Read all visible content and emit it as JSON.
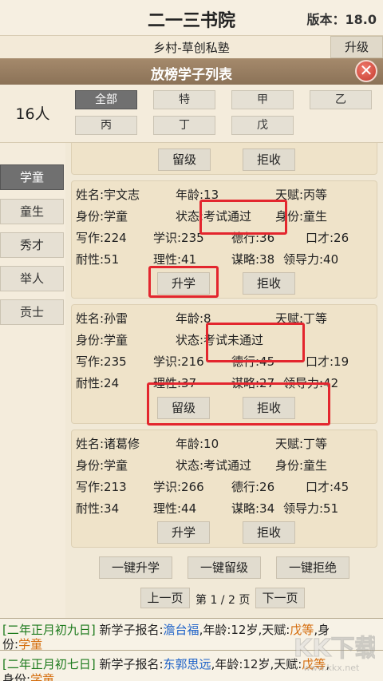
{
  "app": {
    "title": "二一三书院",
    "version_label": "版本：",
    "version_value": "18.0"
  },
  "location": {
    "text": "乡村-草创私塾",
    "upgrade_label": "升级"
  },
  "dialog": {
    "title": "放榜学子列表",
    "close_icon": "close-icon"
  },
  "count_label": "16人",
  "filters": [
    {
      "label": "全部",
      "active": true
    },
    {
      "label": "特"
    },
    {
      "label": "甲"
    },
    {
      "label": "乙"
    },
    {
      "label": "丙"
    },
    {
      "label": "丁"
    },
    {
      "label": "戊"
    }
  ],
  "sidebar": [
    {
      "label": "学童",
      "active": true
    },
    {
      "label": "童生"
    },
    {
      "label": "秀才"
    },
    {
      "label": "举人"
    },
    {
      "label": "贡士"
    }
  ],
  "partial_card": {
    "btn1": "留级",
    "btn2": "拒收"
  },
  "cards": [
    {
      "name": "姓名:宇文志",
      "age": "年龄:13",
      "talent": "天赋:丙等",
      "identity": "身份:学童",
      "status": "状态:考试通过",
      "identity2": "身份:童生",
      "writing": "写作:224",
      "knowledge": "学识:235",
      "virtue": "德行:36",
      "eloquence": "口才:26",
      "patience": "耐性:51",
      "reason": "理性:41",
      "strategy": "谋略:38",
      "leadership": "领导力:40",
      "btn1": "升学",
      "btn2": "拒收"
    },
    {
      "name": "姓名:孙雷",
      "age": "年龄:8",
      "talent": "天赋:丁等",
      "identity": "身份:学童",
      "status": "状态:考试未通过",
      "identity2": "",
      "writing": "写作:235",
      "knowledge": "学识:216",
      "virtue": "德行:45",
      "eloquence": "口才:19",
      "patience": "耐性:24",
      "reason": "理性:37",
      "strategy": "谋略:27",
      "leadership": "领导力:42",
      "btn1": "留级",
      "btn2": "拒收"
    },
    {
      "name": "姓名:诸葛修",
      "age": "年龄:10",
      "talent": "天赋:丁等",
      "identity": "身份:学童",
      "status": "状态:考试通过",
      "identity2": "身份:童生",
      "writing": "写作:213",
      "knowledge": "学识:266",
      "virtue": "德行:26",
      "eloquence": "口才:45",
      "patience": "耐性:34",
      "reason": "理性:44",
      "strategy": "谋略:34",
      "leadership": "领导力:51",
      "btn1": "升学",
      "btn2": "拒收"
    }
  ],
  "actions": {
    "promote_all": "一键升学",
    "retain_all": "一键留级",
    "reject_all": "一键拒绝"
  },
  "pager": {
    "prev": "上一页",
    "info": "第 1 / 2 页",
    "next": "下一页"
  },
  "logs": [
    {
      "date": "[二年正月初九日]",
      "prefix": " 新学子报名:",
      "student": "澹台福",
      "middle": ",年龄:12岁,天赋:",
      "grade": "戊等",
      "end": ",身",
      "line2_label": "份:",
      "line2_value": "学童"
    },
    {
      "date": "[二年正月初七日]",
      "prefix": " 新学子报名:",
      "student": "东郭思远",
      "middle": ",年龄:12岁,天赋:",
      "grade": "戊等",
      "end": ",",
      "line2_label": "身份:",
      "line2_value": "学童"
    }
  ],
  "watermark": {
    "text": "KK下载",
    "url": "www.kkx.net"
  }
}
